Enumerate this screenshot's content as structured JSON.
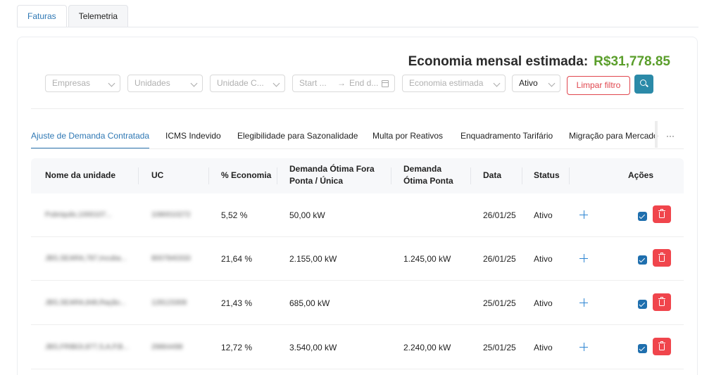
{
  "top_tabs": [
    "Faturas",
    "Telemetria"
  ],
  "economy": {
    "label": "Economia mensal estimada:",
    "value": "R$31,778.85"
  },
  "filters": {
    "empresas": "Empresas",
    "unidades": "Unidades",
    "unidade_c": "Unidade C...",
    "start_date": "Start ...",
    "arrow": "→",
    "end_date": "End d...",
    "economia": "Economia estimada",
    "status": "Ativo",
    "clear_label": "Limpar filtro"
  },
  "sub_tabs": [
    "Ajuste de Demanda Contratada",
    "ICMS Indevido",
    "Elegibilidade para Sazonalidade",
    "Multa por Reativos",
    "Enquadramento Tarifário",
    "Migração para Mercado"
  ],
  "more": "···",
  "table": {
    "headers": {
      "nome": "Nome da unidade",
      "uc": "UC",
      "economia": "% Economia",
      "fora_ponta_1": "Demanda Ótima Fora",
      "fora_ponta_2": "Ponta / Única",
      "ponta_1": "Demanda",
      "ponta_2": "Ótima Ponta",
      "data": "Data",
      "status": "Status",
      "acoes": "Ações"
    },
    "rows": [
      {
        "nome": "Pubriquilo,1000107...",
        "uc": "1080010272",
        "economia": "5,52 %",
        "fora_ponta": "50,00 kW",
        "ponta": "",
        "data": "26/01/25",
        "status": "Ativo"
      },
      {
        "nome": "JBS,SEARA,787,Incuba...",
        "uc": "8007840333",
        "economia": "21,64 %",
        "fora_ponta": "2.155,00 kW",
        "ponta": "1.245,00 kW",
        "data": "26/01/25",
        "status": "Ativo"
      },
      {
        "nome": "JBS,SEARA,848,Ração...",
        "uc": "128123308",
        "economia": "21,43 %",
        "fora_ponta": "685,00 kW",
        "ponta": "",
        "data": "25/01/25",
        "status": "Ativo"
      },
      {
        "nome": "JBS,FRIBOI,877,S,A,P,B...",
        "uc": "29864498",
        "economia": "12,72 %",
        "fora_ponta": "3.540,00 kW",
        "ponta": "2.240,00 kW",
        "data": "25/01/25",
        "status": "Ativo"
      }
    ]
  },
  "colors": {
    "accent": "#2f78b4",
    "economy_green": "#5a9e2b",
    "danger": "#f0454c",
    "search_btn": "#2b8aa8"
  },
  "icons": {
    "add": "plus-icon",
    "check": "checkbox-checked-icon",
    "delete": "trash-icon",
    "search": "search-icon",
    "calendar": "calendar-icon",
    "dropdown": "chevron-down-icon"
  }
}
